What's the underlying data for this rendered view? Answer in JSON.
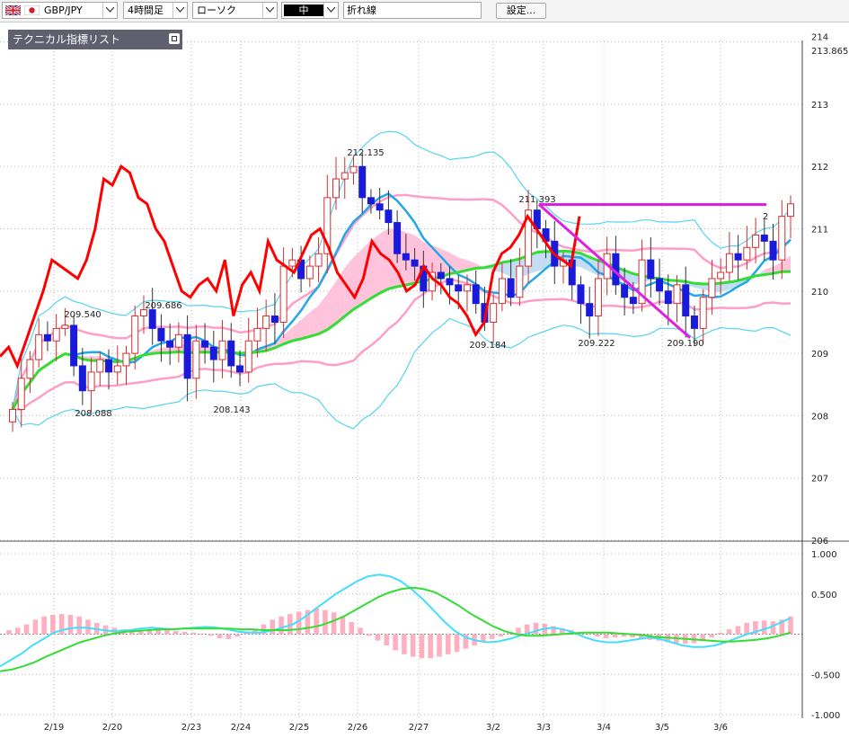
{
  "toolbar": {
    "pair": "GBP/JPY",
    "timeframe": "4時間足",
    "chart_type": "ローソク",
    "size": "中",
    "line_type": "折れ線",
    "settings": "設定..."
  },
  "indicator_panel": {
    "label": "テクニカル指標リスト"
  },
  "colors": {
    "candle_up": "#d03030",
    "candle_down": "#1a1adb",
    "rsi_line": "#ff0000",
    "bb_inner": "#ff9ec8",
    "bb_outer": "#55d4f0",
    "ma_fast": "#22a8e8",
    "ma_slow": "#33dd33",
    "cloud_pos": "#ffb8d6",
    "cloud_neg": "#b9d7f2",
    "trendline": "#e020e0",
    "macd_hist": "#ffb0c0",
    "macd_line": "#44ddff",
    "signal_line": "#33dd33"
  },
  "chart_data": [
    {
      "type": "candlestick",
      "y_ticks": [
        "214",
        "213.865",
        "213",
        "212",
        "211",
        "210",
        "209",
        "208",
        "207",
        "206"
      ],
      "ylim": [
        206,
        214
      ],
      "x_ticks": [
        "2/19",
        "2/20",
        "2/23",
        "2/24",
        "2/25",
        "2/26",
        "2/27",
        "3/2",
        "3/3",
        "3/4",
        "3/5",
        "3/6"
      ],
      "annotations": [
        "209.540",
        "209.686",
        "208.088",
        "208.143",
        "212.135",
        "211.393",
        "209.184",
        "209.222",
        "209.190",
        "2"
      ],
      "series": {
        "close": [
          208.1,
          208.6,
          208.9,
          209.3,
          209.2,
          209.4,
          209.45,
          208.8,
          208.4,
          208.7,
          208.9,
          208.7,
          208.8,
          209.0,
          209.6,
          209.7,
          209.4,
          209.2,
          209.1,
          209.3,
          208.6,
          209.2,
          209.1,
          208.9,
          209.2,
          208.8,
          208.7,
          209.2,
          209.4,
          209.6,
          209.5,
          210.4,
          210.5,
          210.2,
          210.4,
          210.6,
          211.5,
          211.8,
          211.9,
          212.0,
          211.5,
          211.4,
          211.3,
          211.1,
          210.6,
          210.5,
          210.4,
          210.0,
          210.3,
          210.2,
          210.1,
          210.0,
          210.1,
          209.8,
          209.5,
          209.8,
          210.2,
          209.9,
          210.4,
          211.3,
          211.0,
          210.8,
          210.4,
          210.5,
          210.1,
          209.8,
          209.6,
          210.2,
          210.6,
          210.1,
          209.9,
          209.8,
          210.5,
          210.2,
          210.0,
          209.8,
          210.1,
          209.6,
          209.4,
          209.9,
          210.2,
          210.3,
          210.6,
          210.5,
          210.7,
          210.9,
          210.8,
          210.5,
          211.2,
          211.4
        ],
        "rsi_overlay": [
          208.95,
          209.1,
          208.8,
          209.2,
          209.6,
          210.0,
          210.5,
          210.4,
          210.3,
          210.2,
          210.5,
          211.0,
          211.8,
          211.7,
          212.0,
          211.9,
          211.5,
          211.4,
          211.0,
          210.8,
          210.4,
          210.0,
          209.9,
          210.1,
          210.2,
          210.0,
          210.5,
          209.6,
          210.1,
          210.3,
          210.0,
          210.8,
          210.5,
          210.4,
          210.3,
          210.6,
          210.9,
          211.0,
          210.7,
          210.3,
          210.1,
          209.9,
          210.2,
          210.8,
          210.6,
          210.5,
          210.3,
          210.0,
          210.1,
          210.4,
          210.2,
          210.1,
          209.9,
          209.8,
          209.6,
          209.3,
          209.5,
          210.3,
          210.6,
          210.7,
          210.9,
          211.2,
          211.0,
          210.8,
          210.6,
          210.5,
          210.4,
          211.2
        ]
      }
    },
    {
      "type": "bar",
      "y_ticks": [
        "1.000",
        "0.500",
        "-0.500",
        "-1.000"
      ],
      "ylim": [
        -1.0,
        1.0
      ],
      "series": [
        {
          "values": [
            0.05,
            0.08,
            0.12,
            0.18,
            0.22,
            0.24,
            0.25,
            0.24,
            0.22,
            0.18,
            0.14,
            0.11,
            0.08,
            0.06,
            0.05,
            0.04,
            0.04,
            0.05,
            0.05,
            0.04,
            0.03,
            0.02,
            0.01,
            -0.02,
            -0.05,
            -0.06,
            -0.03,
            0.02,
            0.06,
            0.12,
            0.18,
            0.22,
            0.25,
            0.28,
            0.3,
            0.32,
            0.3,
            0.27,
            0.22,
            0.15,
            0.08,
            -0.02,
            -0.08,
            -0.14,
            -0.2,
            -0.25,
            -0.28,
            -0.3,
            -0.3,
            -0.28,
            -0.25,
            -0.22,
            -0.18,
            -0.14,
            -0.1,
            -0.06,
            -0.03,
            0.02,
            0.08,
            0.12,
            0.14,
            0.13,
            0.1,
            0.07,
            0.05,
            0.02,
            -0.01,
            -0.03,
            -0.05,
            -0.04,
            -0.03,
            -0.04,
            -0.05,
            -0.07,
            -0.08,
            -0.1,
            -0.11,
            -0.12,
            -0.11,
            -0.08,
            -0.04,
            0.02,
            0.06,
            0.1,
            0.14,
            0.16,
            0.17,
            0.16,
            0.18,
            0.22
          ]
        },
        {
          "values": [
            -0.4,
            -0.32,
            -0.24,
            -0.14,
            -0.06,
            0.02,
            0.06,
            0.08,
            0.08,
            0.06,
            0.04,
            0.04,
            0.05,
            0.07,
            0.08,
            0.07,
            0.06,
            0.07,
            0.08,
            0.09,
            0.08,
            0.06,
            0.03,
            0.02,
            0.02,
            0.04,
            0.08,
            0.12,
            0.2,
            0.3,
            0.4,
            0.5,
            0.58,
            0.66,
            0.72,
            0.74,
            0.72,
            0.66,
            0.56,
            0.44,
            0.3,
            0.16,
            0.04,
            -0.04,
            -0.08,
            -0.1,
            -0.09,
            -0.06,
            -0.02,
            0.02,
            0.06,
            0.08,
            0.06,
            0.02,
            -0.04,
            -0.08,
            -0.1,
            -0.1,
            -0.08,
            -0.06,
            -0.04,
            -0.06,
            -0.1,
            -0.14,
            -0.16,
            -0.16,
            -0.14,
            -0.1,
            -0.05,
            0.0,
            0.04,
            0.08,
            0.14,
            0.2
          ]
        },
        {
          "values": [
            -0.46,
            -0.44,
            -0.4,
            -0.35,
            -0.28,
            -0.22,
            -0.16,
            -0.1,
            -0.06,
            -0.02,
            0.01,
            0.03,
            0.04,
            0.05,
            0.06,
            0.06,
            0.07,
            0.07,
            0.07,
            0.07,
            0.07,
            0.06,
            0.06,
            0.05,
            0.05,
            0.05,
            0.06,
            0.08,
            0.11,
            0.16,
            0.22,
            0.3,
            0.38,
            0.46,
            0.52,
            0.56,
            0.58,
            0.56,
            0.52,
            0.44,
            0.36,
            0.26,
            0.18,
            0.1,
            0.04,
            0.0,
            -0.02,
            -0.02,
            -0.01,
            0.0,
            0.01,
            0.02,
            0.02,
            0.02,
            0.01,
            0.0,
            -0.01,
            -0.03,
            -0.04,
            -0.05,
            -0.06,
            -0.07,
            -0.08,
            -0.09,
            -0.09,
            -0.08,
            -0.07,
            -0.05,
            -0.02,
            0.02
          ]
        }
      ]
    }
  ]
}
